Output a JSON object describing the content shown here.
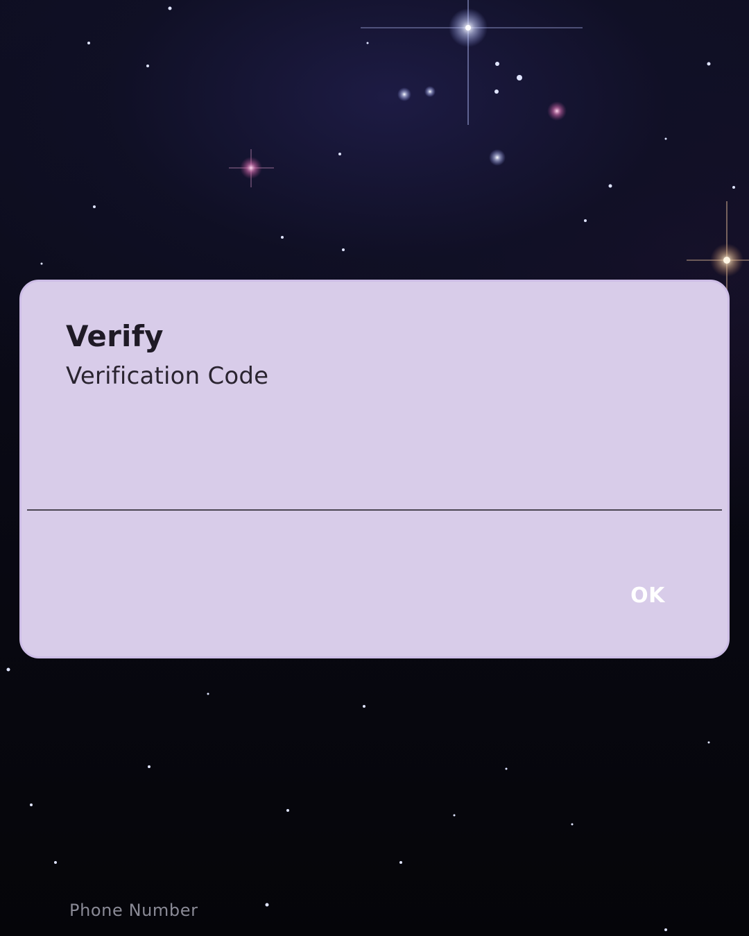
{
  "dialog": {
    "title": "Verify",
    "message": "Verification Code",
    "code_input_value": "",
    "ok_label": "OK"
  },
  "background": {
    "phone_field_label": "Phone Number"
  },
  "colors": {
    "dialog_background": "#d8cce9",
    "dialog_title": "#1f1a26",
    "input_underline": "#4a4552",
    "ok_button_text": "#ffffff",
    "phone_label": "#8a8a96",
    "night_sky": "#07070c"
  }
}
